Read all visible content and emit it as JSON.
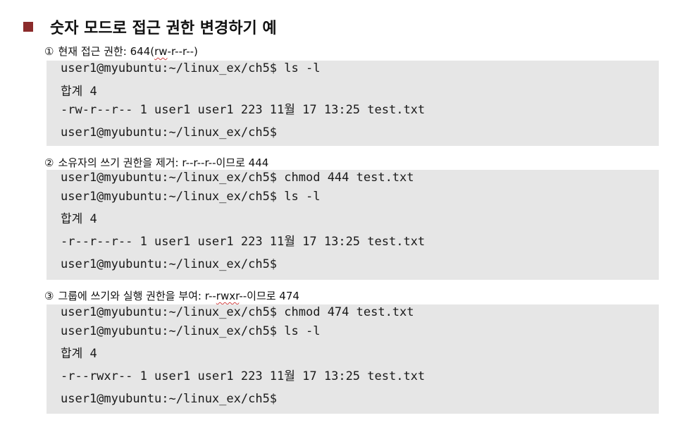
{
  "title": "숫자 모드로 접근 권한 변경하기 예",
  "steps": [
    {
      "num": "①",
      "text_plain": "현재 접근 권한: 644(",
      "text_mark": "rw",
      "text_tail": "-r--r--)",
      "code": [
        "user1@myubuntu:~/linux_ex/ch5$ ls -l",
        "합계 4",
        "-rw-r--r-- 1 user1 user1 223 11월 17 13:25 test.txt",
        "user1@myubuntu:~/linux_ex/ch5$"
      ]
    },
    {
      "num": "②",
      "text_plain": "소유자의 쓰기 권한을 제거:  r--r--r--이므로 444",
      "text_mark": "",
      "text_tail": "",
      "code": [
        "user1@myubuntu:~/linux_ex/ch5$ chmod 444 test.txt",
        "user1@myubuntu:~/linux_ex/ch5$ ls -l",
        "합계 4",
        "-r--r--r-- 1 user1 user1 223 11월 17 13:25 test.txt",
        "user1@myubuntu:~/linux_ex/ch5$"
      ]
    },
    {
      "num": "③",
      "text_plain": "그룹에 쓰기와 실행 권한을 부여: r--",
      "text_mark": "rwxr",
      "text_tail": "--이므로 474",
      "code": [
        "user1@myubuntu:~/linux_ex/ch5$ chmod 474 test.txt",
        "user1@myubuntu:~/linux_ex/ch5$ ls -l",
        "합계 4",
        "-r--rwxr-- 1 user1 user1 223 11월 17 13:25 test.txt",
        "user1@myubuntu:~/linux_ex/ch5$"
      ]
    }
  ]
}
